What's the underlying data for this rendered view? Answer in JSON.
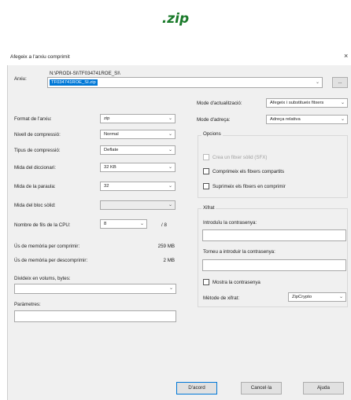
{
  "heading": ".zip",
  "dialog": {
    "title": "Afegeix a l'arxiu comprimit",
    "close_glyph": "×"
  },
  "archive": {
    "label": "Arxiu:",
    "path": "N:\\PRODI-SI\\TF034741ROE_SI\\",
    "filename": "TF034741ROE_SI.zip",
    "browse_label": "..."
  },
  "left": {
    "format": {
      "label": "Format de l'arxiu:",
      "value": "zip"
    },
    "level": {
      "label": "Nivell de compressió:",
      "value": "Normal"
    },
    "method": {
      "label": "Tipus de compressió:",
      "value": "Deflate"
    },
    "dict": {
      "label": "Mida del diccionari:",
      "value": "32 KB"
    },
    "word": {
      "label": "Mida de la paraula:",
      "value": "32"
    },
    "solid": {
      "label": "Mida del bloc sòlid:",
      "value": ""
    },
    "threads": {
      "label": "Nombre de fils de la CPU:",
      "value": "8",
      "max": "/ 8"
    },
    "mem_compress": {
      "label": "Ús de memòria per comprimir:",
      "value": "259 MB"
    },
    "mem_decompress": {
      "label": "Ús de memòria per descomprimir:",
      "value": "2 MB"
    },
    "volumes": {
      "label": "Divideix en volums, bytes:",
      "value": ""
    },
    "params": {
      "label": "Paràmetres:",
      "value": ""
    }
  },
  "right": {
    "update_mode": {
      "label": "Mode d'actualització:",
      "value": "Afegeix i substitueix fitxers"
    },
    "path_mode": {
      "label": "Mode d'adreça:",
      "value": "Adreça relativa"
    },
    "options": {
      "title": "Opcions",
      "sfx": "Crea un fitxer sòlid (SFX)",
      "shared": "Comprimeix els fitxers compartits",
      "delete": "Suprimeix els fitxers en comprimir"
    },
    "encryption": {
      "title": "Xifrat",
      "password_label": "Introduïu la contrasenya:",
      "repeat_label": "Torneu a introduir la contrasenya:",
      "show_password": "Mostra la contrasenya",
      "method_label": "Mètode de xifrat:",
      "method_value": "ZipCrypto"
    }
  },
  "buttons": {
    "ok": "D'acord",
    "cancel": "Cancel·la",
    "help": "Ajuda"
  }
}
